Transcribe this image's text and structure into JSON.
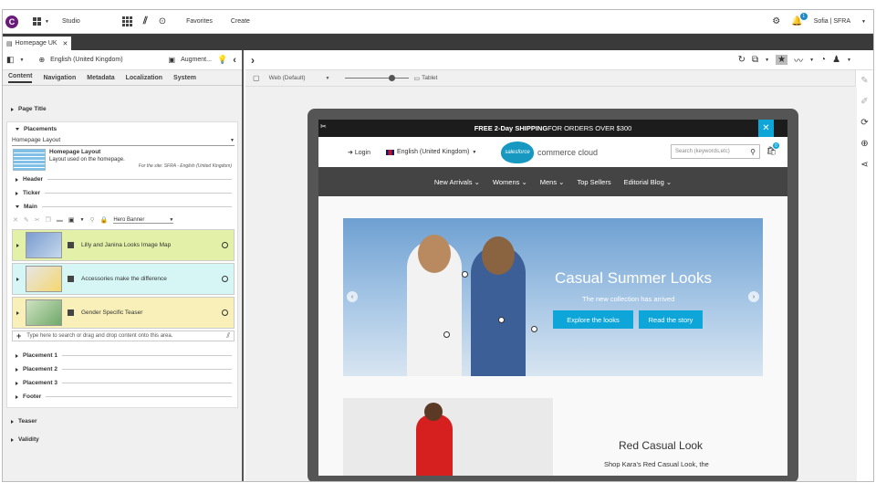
{
  "topbar": {
    "logo": "C",
    "app_name": "Studio",
    "favorites": "Favorites",
    "create": "Create",
    "notification_count": "1",
    "user": "Sofia | SFRA"
  },
  "tabs": [
    {
      "label": "Homepage UK"
    }
  ],
  "left_toolbar": {
    "language": "English (United Kingdom)",
    "augment": "Augment..."
  },
  "left_tabs": [
    "Content",
    "Navigation",
    "Metadata",
    "Localization",
    "System"
  ],
  "sections": {
    "page_title": "Page Title",
    "placements": "Placements",
    "layout_select": "Homepage Layout",
    "layout_name": "Homepage Layout",
    "layout_desc": "Layout used on the homepage.",
    "layout_site": "For the site: SFRA - English (United Kingdom)",
    "header": "Header",
    "ticker": "Ticker",
    "main": "Main",
    "type_select": "Hero Banner",
    "items": [
      {
        "label": "Lilly and Janina Looks Image Map",
        "color": "#e3f0a8"
      },
      {
        "label": "Accessories make the difference",
        "color": "#d6f6f6"
      },
      {
        "label": "Gender Specific Teaser",
        "color": "#f8f0b8"
      }
    ],
    "drop_hint": "Type here to search or drag and drop content onto this area.",
    "placement_1": "Placement 1",
    "placement_2": "Placement 2",
    "placement_3": "Placement 3",
    "footer": "Footer",
    "teaser": "Teaser",
    "validity": "Validity"
  },
  "preview": {
    "channel": "Web (Default)",
    "device": "Tablet"
  },
  "site": {
    "promo_bold": "FREE 2-Day SHIPPING",
    "promo_rest": " FOR ORDERS OVER $300",
    "login": "Login",
    "language": "English (United Kingdom)",
    "logo_small": "salesforce",
    "logo_text": "commerce cloud",
    "search_placeholder": "Search (keywords,etc)",
    "cart_count": "0",
    "nav": [
      "New Arrivals",
      "Womens",
      "Mens",
      "Top Sellers",
      "Editorial Blog"
    ],
    "hero_title": "Casual Summer Looks",
    "hero_sub": "The new collection has arrived",
    "hero_btn1": "Explore the looks",
    "hero_btn2": "Read the story",
    "teaser_title": "Red Casual Look",
    "teaser_sub": "Shop Kara's Red Casual Look, the"
  },
  "colors": {
    "accent": "#0ea5d8",
    "brand": "#6a1b7a"
  }
}
